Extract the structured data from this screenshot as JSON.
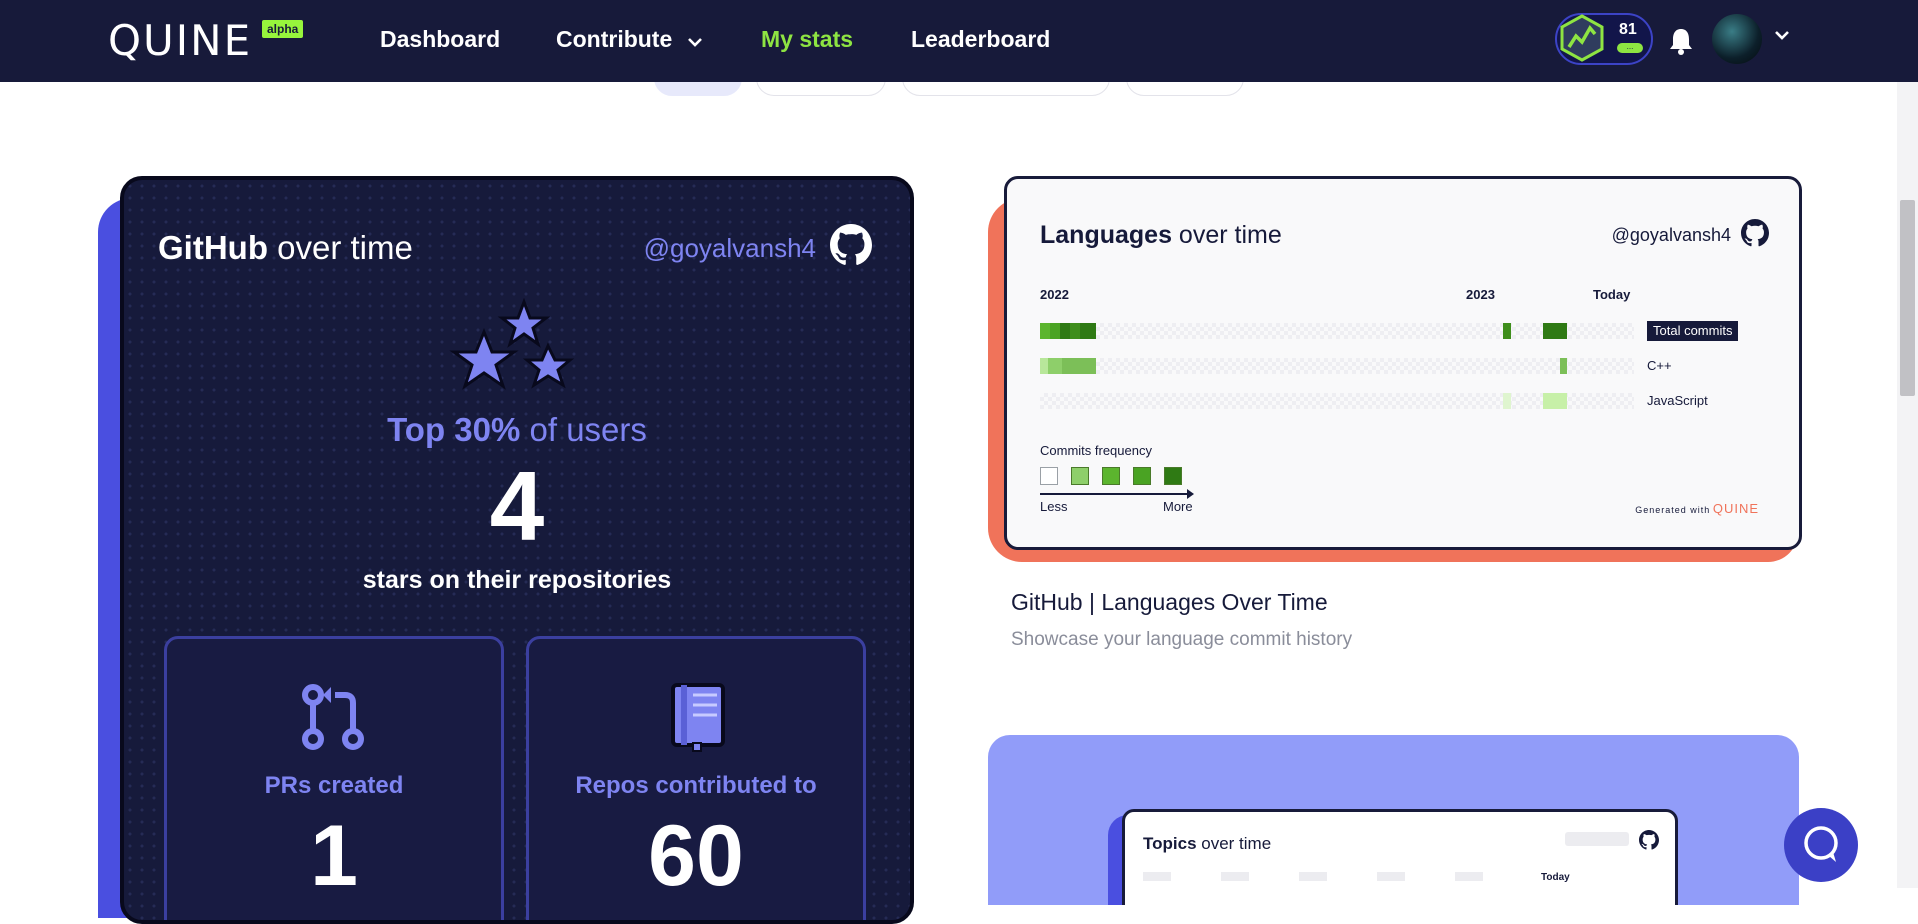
{
  "nav": {
    "logo": "QUINE",
    "badge": "alpha",
    "items": [
      {
        "label": "Dashboard"
      },
      {
        "label": "Contribute"
      },
      {
        "label": "My stats"
      },
      {
        "label": "Leaderboard"
      }
    ],
    "xp": {
      "value": "81",
      "bar_text": "..."
    }
  },
  "github_card": {
    "title_bold": "GitHub",
    "title_rest": " over time",
    "handle": "@goyalvansh4",
    "top_bold": "Top 30%",
    "top_rest": " of users",
    "stars_count": "4",
    "stars_label": "stars on their repositories",
    "stats": [
      {
        "label": "PRs created",
        "value": "1"
      },
      {
        "label": "Repos contributed to",
        "value": "60"
      }
    ]
  },
  "languages_card": {
    "title_bold": "Languages",
    "title_rest": " over time",
    "handle": "@goyalvansh4",
    "years": [
      "2022",
      "2023",
      "Today"
    ],
    "rows": [
      {
        "label": "Total commits"
      },
      {
        "label": "C++"
      },
      {
        "label": "JavaScript"
      }
    ],
    "freq_title": "Commits frequency",
    "less": "Less",
    "more": "More",
    "generated_with": "Generated with",
    "generated_brand": "QUINE",
    "colors": [
      "#ffffff",
      "#8ecf6a",
      "#5cb52e",
      "#4aa323",
      "#2f7a14"
    ]
  },
  "card2": {
    "title": "GitHub | Languages Over Time",
    "subtitle": "Showcase your language commit history"
  },
  "topics_card": {
    "title_bold": "Topics",
    "title_rest": " over time",
    "today": "Today"
  }
}
